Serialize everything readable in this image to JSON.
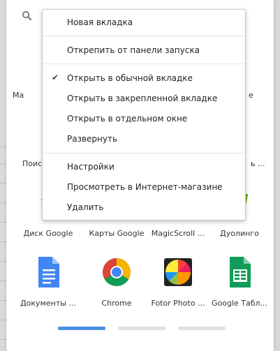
{
  "context_menu": {
    "items": [
      {
        "label": "Новая вкладка",
        "checked": false
      },
      {
        "label": "Открепить от панели запуска",
        "checked": false
      },
      {
        "label": "Открыть в обычной вкладке",
        "checked": true
      },
      {
        "label": "Открыть в закрепленной вкладке",
        "checked": false
      },
      {
        "label": "Открыть в отдельном окне",
        "checked": false
      },
      {
        "label": "Развернуть",
        "checked": false
      },
      {
        "label": "Настройки",
        "checked": false
      },
      {
        "label": "Просмотреть в Интернет-магазине",
        "checked": false
      },
      {
        "label": "Удалить",
        "checked": false
      }
    ],
    "check_glyph": "✔"
  },
  "apps_row_partial": [
    {
      "label": "Ма",
      "icon": "app-icon"
    },
    {
      "label": "е",
      "icon": "app-icon"
    },
    {
      "label": "Поис",
      "icon": "app-icon"
    },
    {
      "label": "ь ...",
      "icon": "app-icon"
    }
  ],
  "apps_row_3": [
    {
      "label": "Диск Google",
      "icon": "google-drive-icon"
    },
    {
      "label": "Карты Google",
      "icon": "google-maps-icon"
    },
    {
      "label": "MagicScroll ...",
      "icon": "magicscroll-icon"
    },
    {
      "label": "Дуолинго",
      "icon": "duolingo-icon"
    }
  ],
  "apps_row_4": [
    {
      "label": "Документы ...",
      "icon": "google-docs-icon"
    },
    {
      "label": "Chrome",
      "icon": "chrome-icon"
    },
    {
      "label": "Fotor Photo ...",
      "icon": "fotor-icon"
    },
    {
      "label": "Google Табл...",
      "icon": "google-sheets-icon"
    }
  ],
  "pagination": {
    "pages": 3,
    "active": 0
  },
  "colors": {
    "accent": "#4a90e2",
    "docs_blue": "#4285f4",
    "sheets_green": "#0f9d58",
    "drive_green": "#0f9d58",
    "duolingo_green": "#58a700"
  }
}
